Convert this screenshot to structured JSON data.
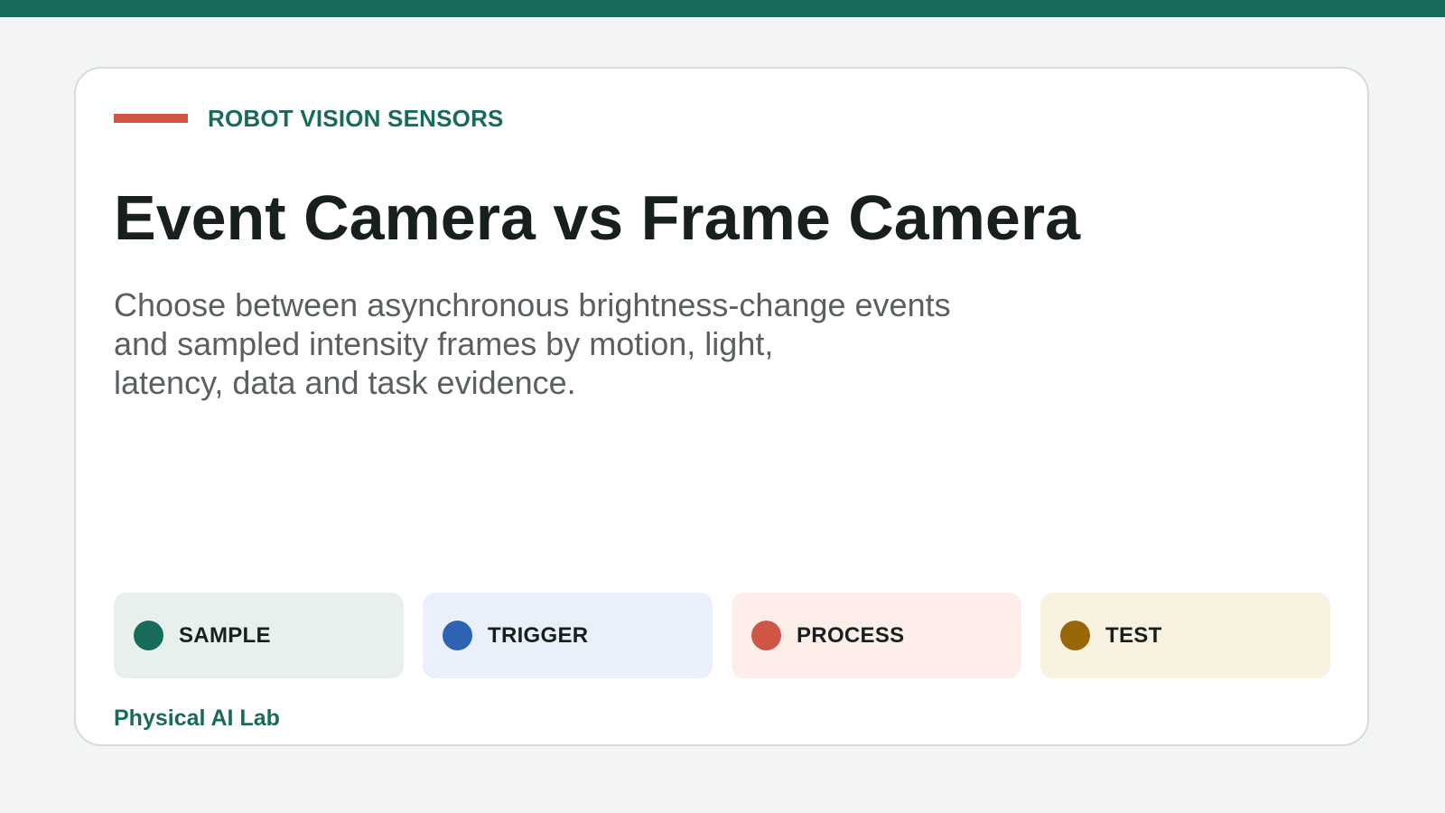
{
  "colors": {
    "brand": "#186b5a",
    "accent": "#cf5644",
    "page_background": "#f2f5f4",
    "card_background": "#ffffff"
  },
  "header": {
    "eyebrow": "ROBOT VISION SENSORS",
    "title": "Event Camera vs Frame Camera",
    "subtitle": "Choose between asynchronous brightness-change events\nand sampled intensity frames by motion, light,\nlatency, data and task evidence."
  },
  "chips": [
    {
      "label": "SAMPLE",
      "dot_color": "#186b5a",
      "background": "#e7f0ec"
    },
    {
      "label": "TRIGGER",
      "dot_color": "#2c64b3",
      "background": "#e9f0f9"
    },
    {
      "label": "PROCESS",
      "dot_color": "#cf5644",
      "background": "#fdeeea"
    },
    {
      "label": "TEST",
      "dot_color": "#9a6706",
      "background": "#faf2e0"
    }
  ],
  "footer": {
    "brand": "Physical AI Lab"
  }
}
